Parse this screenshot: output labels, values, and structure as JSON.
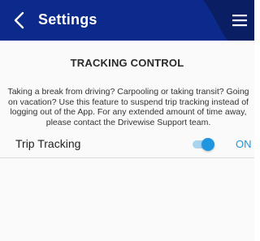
{
  "header": {
    "title": "Settings",
    "back_icon": "chevron-left-icon",
    "menu_icon": "hamburger-menu-icon",
    "colors": {
      "background": "#0b2a8c",
      "text": "#ffffff"
    }
  },
  "tracking_control": {
    "heading": "TRACKING CONTROL",
    "description": "Taking a break from driving? Carpooling or taking transit? Going on vacation? Use this feature to suspend trip tracking instead of logging out of the App. For any extended amount of time away, please contact the Drivewise Support team.",
    "trip_tracking": {
      "label": "Trip Tracking",
      "enabled": true,
      "status": "ON",
      "accent_color": "#2196e0"
    }
  }
}
